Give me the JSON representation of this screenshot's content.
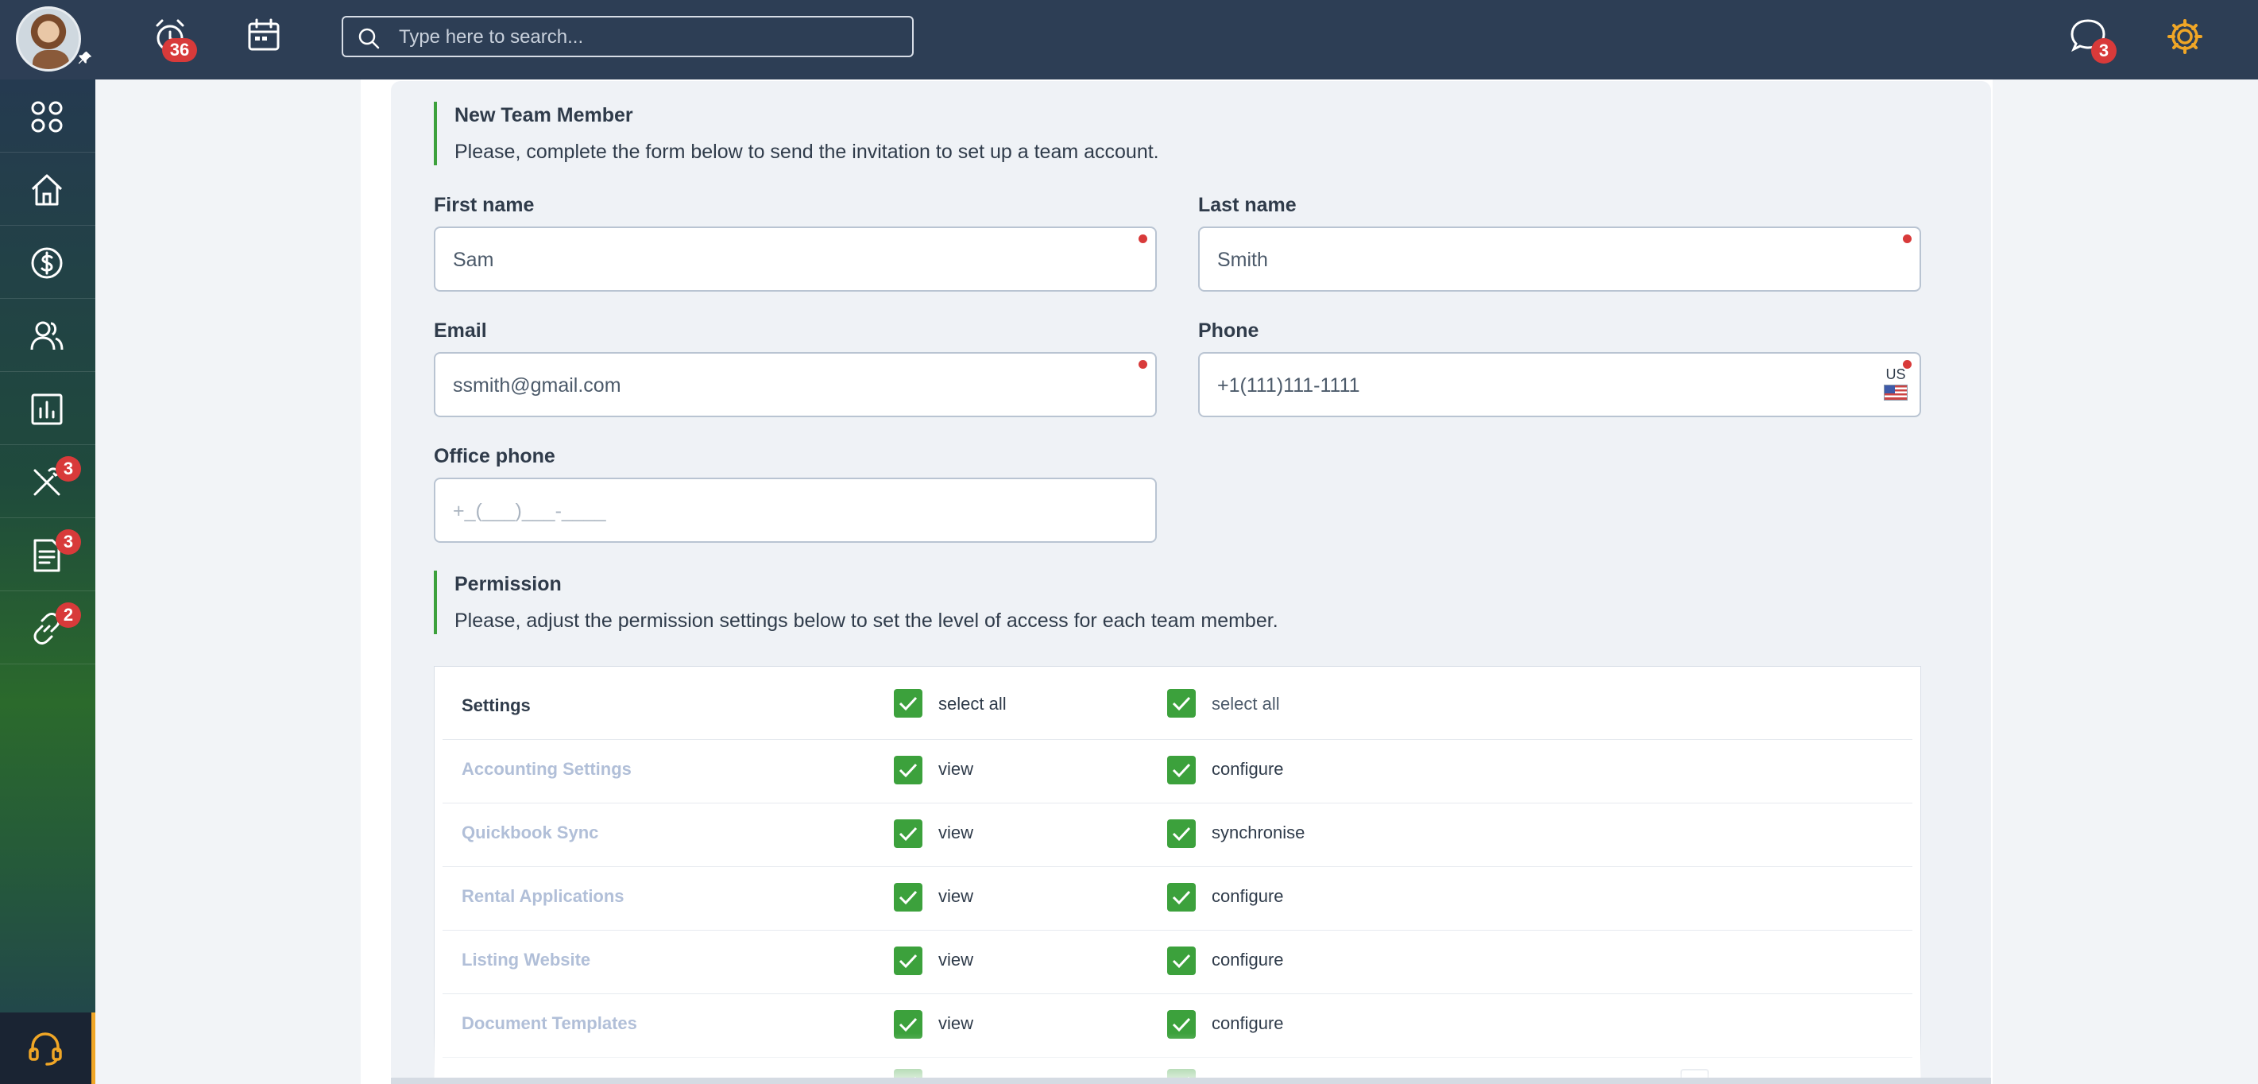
{
  "topbar": {
    "alarm_badge": "36",
    "search_placeholder": "Type here to search...",
    "chat_badge": "3"
  },
  "sidebar": {
    "items": [
      {
        "name": "dashboard",
        "badge": ""
      },
      {
        "name": "home",
        "badge": ""
      },
      {
        "name": "accounting",
        "badge": ""
      },
      {
        "name": "people",
        "badge": ""
      },
      {
        "name": "reports",
        "badge": ""
      },
      {
        "name": "maintenance",
        "badge": "3"
      },
      {
        "name": "documents",
        "badge": "3"
      },
      {
        "name": "links",
        "badge": "2"
      }
    ]
  },
  "new_member": {
    "title": "New Team Member",
    "description": "Please, complete the form below to send the invitation to set up a team account."
  },
  "form": {
    "first_name_label": "First name",
    "first_name_value": "Sam",
    "last_name_label": "Last name",
    "last_name_value": "Smith",
    "email_label": "Email",
    "email_value": "ssmith@gmail.com",
    "phone_label": "Phone",
    "phone_value": "+1(111)111-1111",
    "phone_country": "US",
    "office_phone_label": "Office phone",
    "office_phone_placeholder": "+_(___)___-____"
  },
  "permission": {
    "title": "Permission",
    "description": "Please, adjust the permission settings below to set the level of access for each team member.",
    "rows": [
      {
        "name": "Settings",
        "col1": "select all",
        "col2": "select all"
      },
      {
        "name": "Accounting Settings",
        "col1": "view",
        "col2": "configure"
      },
      {
        "name": "Quickbook Sync",
        "col1": "view",
        "col2": "synchronise"
      },
      {
        "name": "Rental Applications",
        "col1": "view",
        "col2": "configure"
      },
      {
        "name": "Listing Website",
        "col1": "view",
        "col2": "configure"
      },
      {
        "name": "Document Templates",
        "col1": "view",
        "col2": "configure"
      }
    ]
  },
  "colors": {
    "topbar": "#2d3e55",
    "accent_green": "#3ca13c",
    "badge_red": "#d83a3a",
    "gear_orange": "#f0a626"
  }
}
